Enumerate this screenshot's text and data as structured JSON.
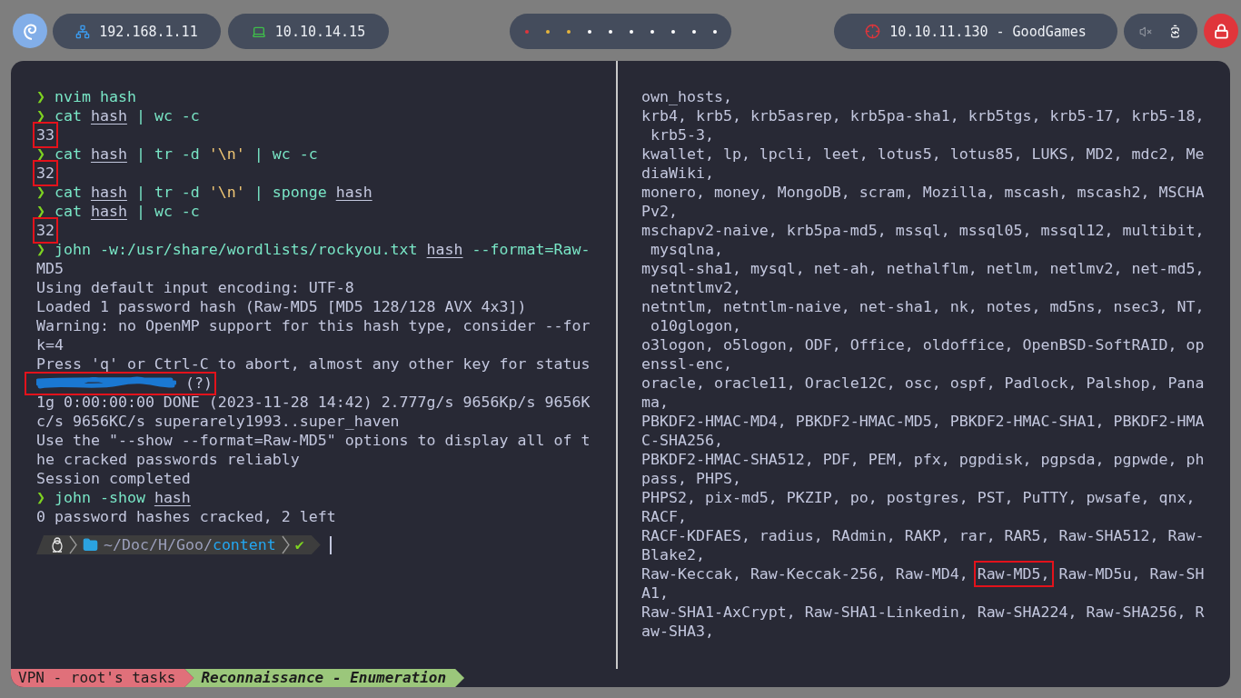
{
  "top_bar": {
    "addresses": [
      {
        "kind": "ethernet",
        "text": "192.168.1.11"
      },
      {
        "kind": "vpn",
        "text": "10.10.14.15"
      }
    ],
    "workspaces": [
      {
        "color": "#e0353b"
      },
      {
        "color": "#e5b43c"
      },
      {
        "color": "#e5b43c"
      },
      {
        "color": "#ffffff"
      },
      {
        "color": "#ffffff"
      },
      {
        "color": "#ffffff"
      },
      {
        "color": "#ffffff"
      },
      {
        "color": "#ffffff"
      },
      {
        "color": "#ffffff"
      },
      {
        "color": "#ffffff"
      }
    ],
    "target": "10.10.11.130 - GoodGames",
    "muted": true
  },
  "left_pane": {
    "lines": [
      {
        "segs": [
          {
            "kind": "prompt",
            "text": "❯ "
          },
          {
            "kind": "cmd",
            "text": "nvim hash"
          }
        ]
      },
      {
        "segs": [
          {
            "kind": "prompt",
            "text": "❯ "
          },
          {
            "kind": "cmd",
            "text": "cat "
          },
          {
            "kind": "file",
            "text": "hash"
          },
          {
            "kind": "cmd",
            "text": " | wc -c"
          }
        ]
      },
      {
        "segs": [
          {
            "kind": "out",
            "text": "33",
            "boxed": true
          }
        ]
      },
      {
        "segs": [
          {
            "kind": "prompt",
            "text": "❯ "
          },
          {
            "kind": "cmd",
            "text": "cat "
          },
          {
            "kind": "file",
            "text": "hash"
          },
          {
            "kind": "cmd",
            "text": " | tr -d "
          },
          {
            "kind": "string",
            "text": "'\\n'"
          },
          {
            "kind": "cmd",
            "text": " | wc -c"
          }
        ]
      },
      {
        "segs": [
          {
            "kind": "out",
            "text": "32",
            "boxed": true
          }
        ]
      },
      {
        "segs": [
          {
            "kind": "prompt",
            "text": "❯ "
          },
          {
            "kind": "cmd",
            "text": "cat "
          },
          {
            "kind": "file",
            "text": "hash"
          },
          {
            "kind": "cmd",
            "text": " | tr -d "
          },
          {
            "kind": "string",
            "text": "'\\n'"
          },
          {
            "kind": "cmd",
            "text": " | sponge "
          },
          {
            "kind": "file",
            "text": "hash"
          }
        ]
      },
      {
        "segs": [
          {
            "kind": "prompt",
            "text": "❯ "
          },
          {
            "kind": "cmd",
            "text": "cat "
          },
          {
            "kind": "file",
            "text": "hash"
          },
          {
            "kind": "cmd",
            "text": " | wc -c"
          }
        ]
      },
      {
        "segs": [
          {
            "kind": "out",
            "text": "32",
            "boxed": true
          }
        ]
      },
      {
        "segs": [
          {
            "kind": "prompt",
            "text": "❯ "
          },
          {
            "kind": "cmd",
            "text": "john -w:/usr/share/wordlists/rockyou.txt "
          },
          {
            "kind": "file",
            "text": "hash"
          },
          {
            "kind": "cmd",
            "text": " --format=Raw-"
          }
        ]
      },
      {
        "segs": [
          {
            "kind": "out",
            "text": "MD5"
          }
        ]
      },
      {
        "segs": [
          {
            "kind": "out",
            "text": "Using default input encoding: UTF-8"
          }
        ]
      },
      {
        "segs": [
          {
            "kind": "out",
            "text": "Loaded 1 password hash (Raw-MD5 [MD5 128/128 AVX 4x3])"
          }
        ]
      },
      {
        "segs": [
          {
            "kind": "out",
            "text": "Warning: no OpenMP support for this hash type, consider --for"
          }
        ]
      },
      {
        "segs": [
          {
            "kind": "out",
            "text": "k=4"
          }
        ]
      },
      {
        "segs": [
          {
            "kind": "out",
            "text": "Press 'q' or Ctrl-C to abort, almost any other key for status"
          }
        ]
      },
      {
        "segs": [
          {
            "kind": "redacted",
            "text": " (?)",
            "boxed": true
          }
        ]
      },
      {
        "segs": [
          {
            "kind": "out",
            "text": "1g 0:00:00:00 DONE (2023-11-28 14:42) 2.777g/s 9656Kp/s 9656K"
          }
        ]
      },
      {
        "segs": [
          {
            "kind": "out",
            "text": "c/s 9656KC/s superarely1993..super_haven"
          }
        ]
      },
      {
        "segs": [
          {
            "kind": "out",
            "text": "Use the \"--show --format=Raw-MD5\" options to display all of t"
          }
        ]
      },
      {
        "segs": [
          {
            "kind": "out",
            "text": "he cracked passwords reliably"
          }
        ]
      },
      {
        "segs": [
          {
            "kind": "out",
            "text": "Session completed"
          }
        ]
      },
      {
        "segs": [
          {
            "kind": "prompt",
            "text": "❯ "
          },
          {
            "kind": "cmd",
            "text": "john -show "
          },
          {
            "kind": "file",
            "text": "hash"
          }
        ]
      },
      {
        "segs": [
          {
            "kind": "out",
            "text": "0 password hashes cracked, 2 left"
          }
        ]
      }
    ],
    "prompt": {
      "path_prefix": "~/Doc/H/Goo/",
      "path_current": "content",
      "status": "✔"
    }
  },
  "right_pane": {
    "lines": [
      {
        "segs": [
          {
            "kind": "out",
            "text": "own_hosts,"
          }
        ]
      },
      {
        "segs": [
          {
            "kind": "out",
            "text": "krb4, krb5, krb5asrep, krb5pa-sha1, krb5tgs, krb5-17, krb5-18,"
          }
        ]
      },
      {
        "segs": [
          {
            "kind": "out",
            "text": " krb5-3,"
          }
        ]
      },
      {
        "segs": [
          {
            "kind": "out",
            "text": "kwallet, lp, lpcli, leet, lotus5, lotus85, LUKS, MD2, mdc2, Me"
          }
        ]
      },
      {
        "segs": [
          {
            "kind": "out",
            "text": "diaWiki,"
          }
        ]
      },
      {
        "segs": [
          {
            "kind": "out",
            "text": "monero, money, MongoDB, scram, Mozilla, mscash, mscash2, MSCHA"
          }
        ]
      },
      {
        "segs": [
          {
            "kind": "out",
            "text": "Pv2,"
          }
        ]
      },
      {
        "segs": [
          {
            "kind": "out",
            "text": "mschapv2-naive, krb5pa-md5, mssql, mssql05, mssql12, multibit,"
          }
        ]
      },
      {
        "segs": [
          {
            "kind": "out",
            "text": " mysqlna,"
          }
        ]
      },
      {
        "segs": [
          {
            "kind": "out",
            "text": "mysql-sha1, mysql, net-ah, nethalflm, netlm, netlmv2, net-md5,"
          }
        ]
      },
      {
        "segs": [
          {
            "kind": "out",
            "text": " netntlmv2,"
          }
        ]
      },
      {
        "segs": [
          {
            "kind": "out",
            "text": "netntlm, netntlm-naive, net-sha1, nk, notes, md5ns, nsec3, NT,"
          }
        ]
      },
      {
        "segs": [
          {
            "kind": "out",
            "text": " o10glogon,"
          }
        ]
      },
      {
        "segs": [
          {
            "kind": "out",
            "text": "o3logon, o5logon, ODF, Office, oldoffice, OpenBSD-SoftRAID, op"
          }
        ]
      },
      {
        "segs": [
          {
            "kind": "out",
            "text": "enssl-enc,"
          }
        ]
      },
      {
        "segs": [
          {
            "kind": "out",
            "text": "oracle, oracle11, Oracle12C, osc, ospf, Padlock, Palshop, Pana"
          }
        ]
      },
      {
        "segs": [
          {
            "kind": "out",
            "text": "ma,"
          }
        ]
      },
      {
        "segs": [
          {
            "kind": "out",
            "text": "PBKDF2-HMAC-MD4, PBKDF2-HMAC-MD5, PBKDF2-HMAC-SHA1, PBKDF2-HMA"
          }
        ]
      },
      {
        "segs": [
          {
            "kind": "out",
            "text": "C-SHA256,"
          }
        ]
      },
      {
        "segs": [
          {
            "kind": "out",
            "text": "PBKDF2-HMAC-SHA512, PDF, PEM, pfx, pgpdisk, pgpsda, pgpwde, ph"
          }
        ]
      },
      {
        "segs": [
          {
            "kind": "out",
            "text": "pass, PHPS,"
          }
        ]
      },
      {
        "segs": [
          {
            "kind": "out",
            "text": "PHPS2, pix-md5, PKZIP, po, postgres, PST, PuTTY, pwsafe, qnx,"
          }
        ]
      },
      {
        "segs": [
          {
            "kind": "out",
            "text": "RACF,"
          }
        ]
      },
      {
        "segs": [
          {
            "kind": "out",
            "text": "RACF-KDFAES, radius, RAdmin, RAKP, rar, RAR5, Raw-SHA512, Raw-"
          }
        ]
      },
      {
        "segs": [
          {
            "kind": "out",
            "text": "Blake2,"
          }
        ]
      },
      {
        "segs": [
          {
            "kind": "out",
            "text": "Raw-Keccak, Raw-Keccak-256, Raw-MD4, "
          },
          {
            "kind": "out",
            "text": "Raw-MD5,",
            "boxed": true
          },
          {
            "kind": "out",
            "text": " Raw-MD5u, Raw-SH"
          }
        ]
      },
      {
        "segs": [
          {
            "kind": "out",
            "text": "A1,"
          }
        ]
      },
      {
        "segs": [
          {
            "kind": "out",
            "text": "Raw-SHA1-AxCrypt, Raw-SHA1-Linkedin, Raw-SHA224, Raw-SHA256, R"
          }
        ]
      },
      {
        "segs": [
          {
            "kind": "out",
            "text": "aw-SHA3,"
          }
        ]
      }
    ]
  },
  "status_bar": {
    "items": [
      {
        "kind": "session",
        "label": "VPN - root's tasks"
      },
      {
        "kind": "window",
        "label": "Reconnaissance - Enumeration"
      }
    ]
  }
}
